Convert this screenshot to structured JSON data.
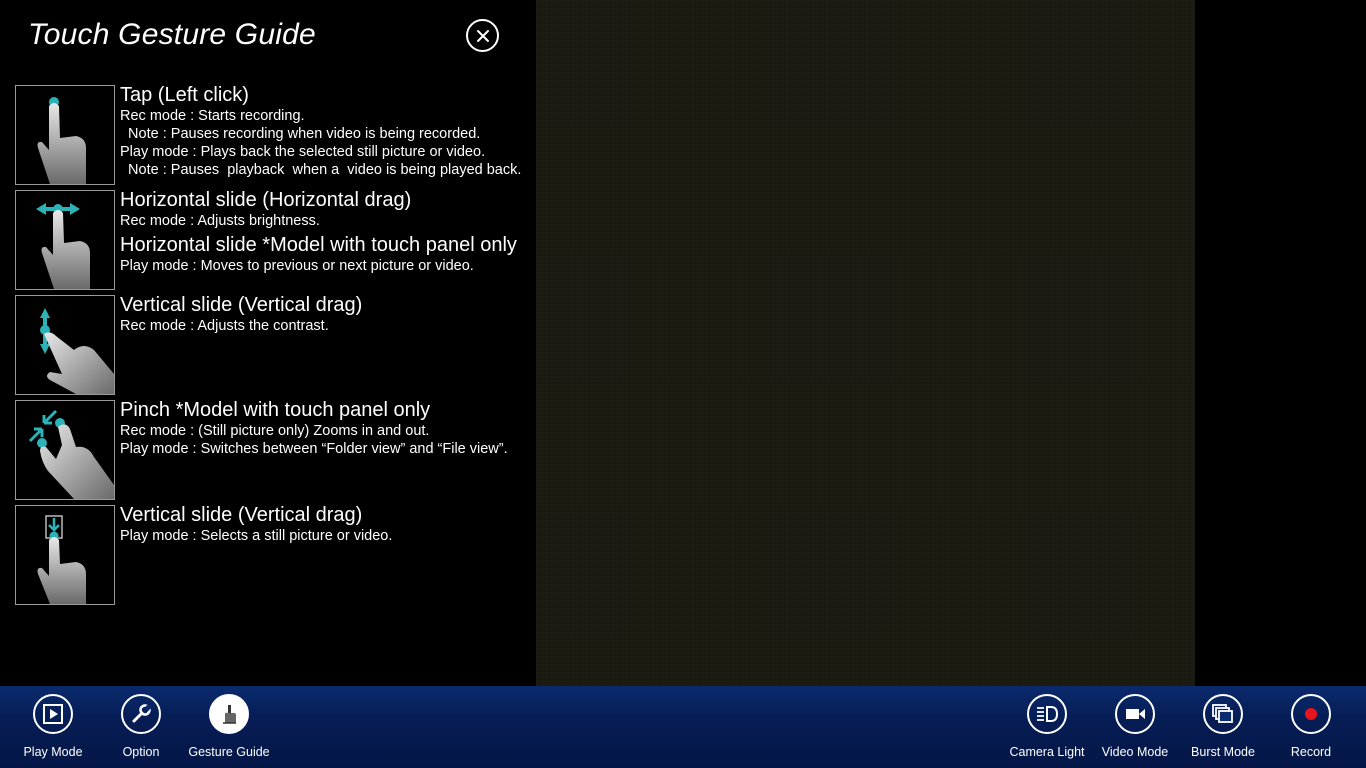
{
  "guide": {
    "title": "Touch Gesture Guide",
    "close_icon": "close-icon",
    "items": [
      {
        "title": "Tap (Left click)",
        "icon": "tap-gesture-icon",
        "lines": [
          "Rec mode : Starts recording.",
          "  Note : Pauses recording when video is being recorded.",
          "Play mode : Plays back the selected still picture or video.",
          "  Note : Pauses  playback  when a  video is being played back."
        ]
      },
      {
        "title": "Horizontal slide (Horizontal drag)",
        "icon": "horizontal-slide-gesture-icon",
        "lines": [
          "Rec mode : Adjusts brightness."
        ],
        "title2": "Horizontal slide *Model with touch panel only",
        "lines2": [
          "Play mode : Moves to previous or next picture or video."
        ]
      },
      {
        "title": "Vertical slide (Vertical drag)",
        "icon": "vertical-slide-gesture-icon",
        "lines": [
          "Rec mode : Adjusts the contrast."
        ]
      },
      {
        "title": "Pinch *Model with touch panel only",
        "icon": "pinch-gesture-icon",
        "lines": [
          "Rec mode : (Still picture only) Zooms in and out.",
          "Play mode : Switches between “Folder view” and “File view”."
        ]
      },
      {
        "title": "Vertical slide (Vertical drag)",
        "icon": "select-slide-gesture-icon",
        "lines": [
          "Play mode : Selects a still picture or video."
        ]
      }
    ]
  },
  "appbar": {
    "left": [
      {
        "label": "Play Mode",
        "icon": "play-mode-icon"
      },
      {
        "label": "Option",
        "icon": "wrench-icon"
      },
      {
        "label": "Gesture Guide",
        "icon": "gesture-guide-icon",
        "active": true
      }
    ],
    "right": [
      {
        "label": "Camera Light",
        "icon": "camera-light-icon"
      },
      {
        "label": "Video Mode",
        "icon": "video-camera-icon"
      },
      {
        "label": "Burst Mode",
        "icon": "burst-mode-icon"
      },
      {
        "label": "Record",
        "icon": "record-icon"
      }
    ]
  },
  "colors": {
    "accent": "#2bb3b8",
    "appbar": "#061d55",
    "record": "#e8141d"
  }
}
